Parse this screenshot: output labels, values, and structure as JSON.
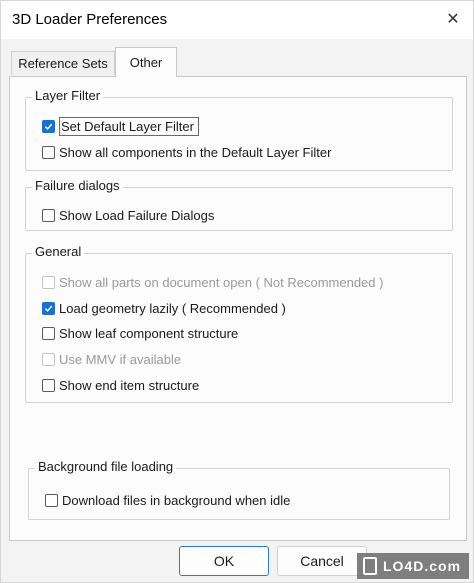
{
  "window": {
    "title": "3D Loader Preferences",
    "close_glyph": "✕"
  },
  "tabs": [
    {
      "label": "Reference Sets",
      "selected": false
    },
    {
      "label": "Other",
      "selected": true
    }
  ],
  "groups": {
    "layer_filter": {
      "label": "Layer Filter",
      "items": [
        {
          "label": "Set Default Layer Filter",
          "checked": true,
          "enabled": true,
          "focused": true
        },
        {
          "label": "Show all components in the Default Layer Filter",
          "checked": false,
          "enabled": true
        }
      ]
    },
    "failure_dialogs": {
      "label": "Failure dialogs",
      "items": [
        {
          "label": "Show Load Failure Dialogs",
          "checked": false,
          "enabled": true
        }
      ]
    },
    "general": {
      "label": "General",
      "items": [
        {
          "label": "Show all parts on document open ( Not Recommended )",
          "checked": false,
          "enabled": false
        },
        {
          "label": "Load geometry lazily ( Recommended )",
          "checked": true,
          "enabled": true
        },
        {
          "label": "Show leaf component structure",
          "checked": false,
          "enabled": true
        },
        {
          "label": "Use MMV if available",
          "checked": false,
          "enabled": false
        },
        {
          "label": "Show end item structure",
          "checked": false,
          "enabled": true
        }
      ]
    },
    "background": {
      "label": "Background file loading",
      "items": [
        {
          "label": "Download files in background when idle",
          "checked": false,
          "enabled": true
        }
      ]
    }
  },
  "buttons": {
    "ok": "OK",
    "cancel": "Cancel"
  },
  "watermark": "LO4D.com",
  "colors": {
    "accent": "#1a6fd1"
  }
}
